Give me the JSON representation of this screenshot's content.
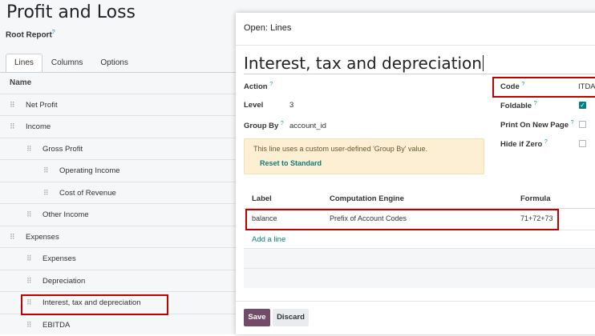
{
  "background": {
    "title": "Profit and Loss",
    "subtitle": "Root Report",
    "tabs": [
      "Lines",
      "Columns",
      "Options"
    ],
    "column_header": "Name",
    "rows": [
      "Net Profit",
      "Income",
      "Gross Profit",
      "Operating Income",
      "Cost of Revenue",
      "Other Income",
      "Expenses",
      "Expenses",
      "Depreciation",
      "Interest, tax and depreciation",
      "EBITDA"
    ]
  },
  "dialog": {
    "header": "Open: Lines",
    "name_value": "Interest, tax and depreciation",
    "fields": {
      "action_label": "Action",
      "level_label": "Level",
      "level_value": "3",
      "group_by_label": "Group By",
      "group_by_value": "account_id",
      "code_label": "Code",
      "code_value": "ITDA",
      "foldable_label": "Foldable",
      "foldable_checked": true,
      "print_label": "Print On New Page",
      "print_checked": false,
      "hide_zero_label": "Hide if Zero",
      "hide_zero_checked": false
    },
    "alert": {
      "text": "This line uses a custom user-defined 'Group By' value.",
      "link": "Reset to Standard"
    },
    "table": {
      "headers": [
        "Label",
        "Computation Engine",
        "Formula"
      ],
      "rows": [
        {
          "label": "balance",
          "engine": "Prefix of Account Codes",
          "formula": "71+72+73"
        }
      ],
      "add_line": "Add a line"
    },
    "buttons": {
      "save": "Save",
      "discard": "Discard"
    }
  },
  "colors": {
    "primary": "#714b67",
    "accent_link": "#117a7a",
    "highlight": "#c00000",
    "alert_bg": "#fcefd3"
  }
}
